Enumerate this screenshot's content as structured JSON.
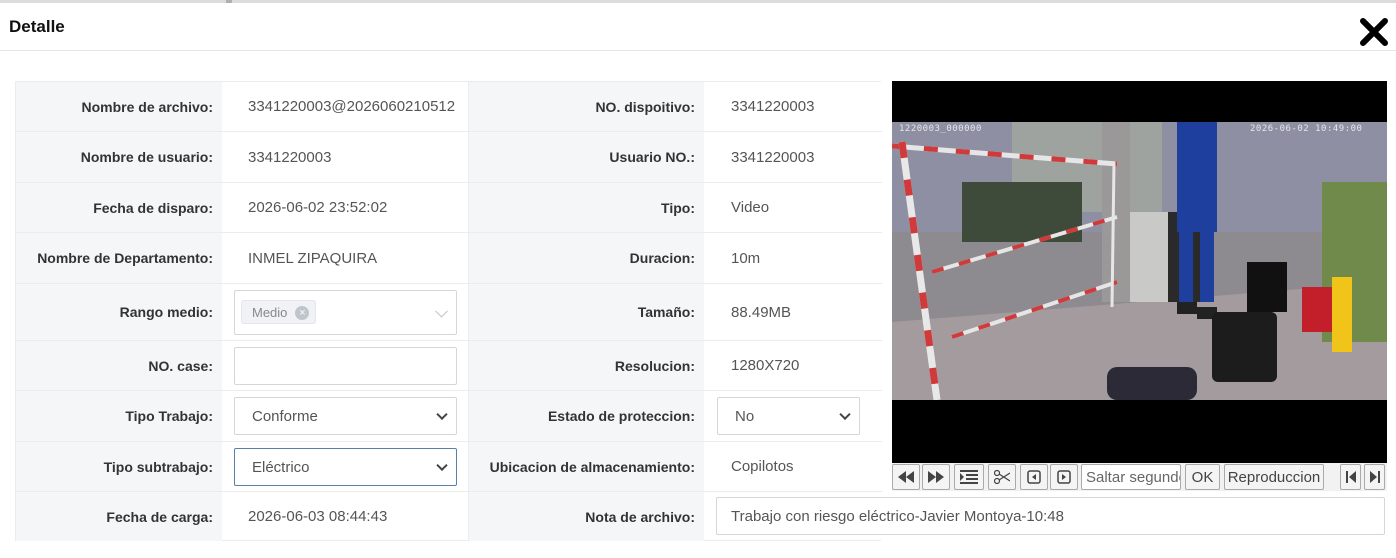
{
  "dialog": {
    "title": "Detalle",
    "close_icon": "close-x-icon"
  },
  "fields": {
    "filename": {
      "label": "Nombre de archivo:",
      "value": "3341220003@2026060210512"
    },
    "device_no": {
      "label": "NO. dispoitivo:",
      "value": "3341220003"
    },
    "username": {
      "label": "Nombre de usuario:",
      "value": "3341220003"
    },
    "user_no": {
      "label": "Usuario NO.:",
      "value": "3341220003"
    },
    "trigger_date": {
      "label": "Fecha de disparo:",
      "value": "2026-06-02 23:52:02"
    },
    "type": {
      "label": "Tipo:",
      "value": "Video"
    },
    "department": {
      "label": "Nombre de Departamento:",
      "value": "INMEL ZIPAQUIRA"
    },
    "duration": {
      "label": "Duracion:",
      "value": "10m"
    },
    "media_range": {
      "label": "Rango medio:",
      "tag": "Medio"
    },
    "size": {
      "label": "Tamaño:",
      "value": "88.49MB"
    },
    "case_no": {
      "label": "NO. case:",
      "value": ""
    },
    "resolution": {
      "label": "Resolucion:",
      "value": "1280X720"
    },
    "work_type": {
      "label": "Tipo Trabajo:",
      "value": "Conforme"
    },
    "protection": {
      "label": "Estado de proteccion:",
      "value": "No"
    },
    "work_subtype": {
      "label": "Tipo subtrabajo:",
      "value": "Eléctrico"
    },
    "storage": {
      "label": "Ubicacion de almacenamiento:",
      "value": "Copilotos"
    },
    "upload_date": {
      "label": "Fecha de carga:",
      "value": "2026-06-03 08:44:43"
    },
    "file_note": {
      "label": "Nota de archivo:",
      "value": "Trabajo con riesgo eléctrico-Javier Montoya-10:48"
    }
  },
  "video": {
    "osd_left": "1220003_000000",
    "osd_right": "2026-06-02 10:49:00"
  },
  "player": {
    "seek_placeholder": "Saltar segundos",
    "ok_label": "OK",
    "playback_label": "Reproduccion",
    "icons": [
      "rewind-icon",
      "fast-forward-icon",
      "list-icon",
      "scissors-icon",
      "frame-back-icon",
      "frame-forward-icon",
      "skip-start-icon",
      "skip-end-icon"
    ]
  }
}
